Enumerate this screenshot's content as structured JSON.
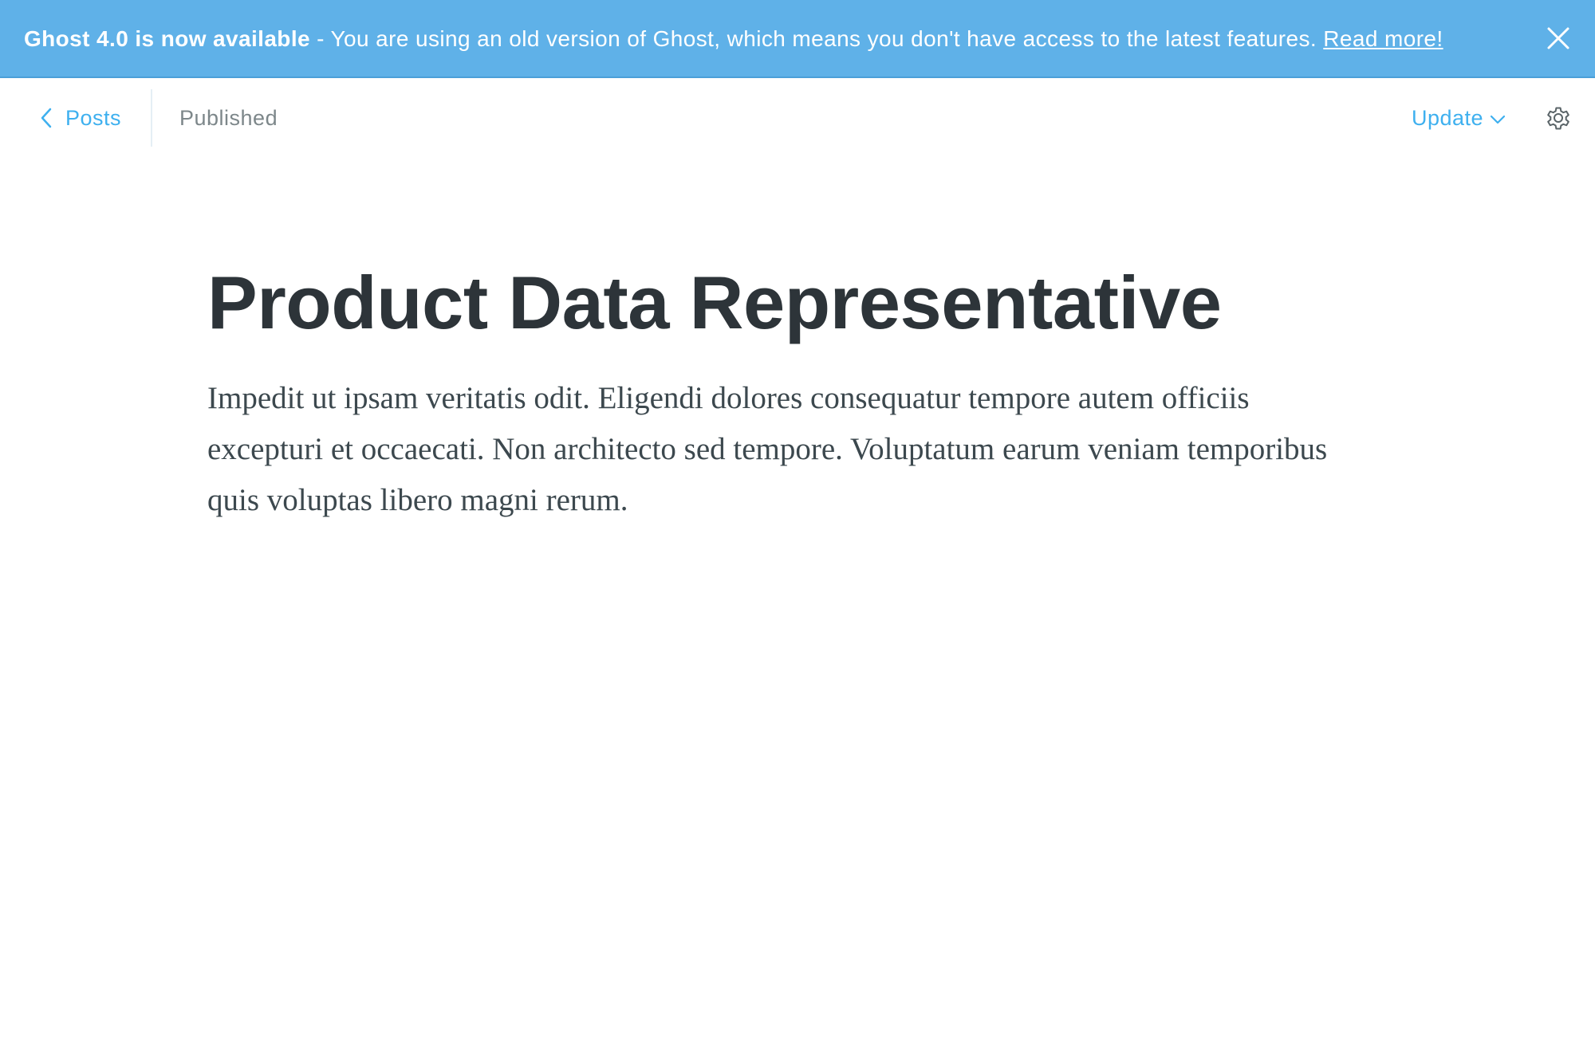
{
  "banner": {
    "headline": "Ghost 4.0 is now available",
    "separator": " - ",
    "message": "You are using an old version of Ghost, which means you don't have access to the latest features.",
    "link_label": "Read more!",
    "close_icon": "close-icon",
    "background_color": "#5fb1e8"
  },
  "toolbar": {
    "back_label": "Posts",
    "back_icon": "chevron-left-icon",
    "status": "Published",
    "update_label": "Update",
    "update_icon": "chevron-down-icon",
    "settings_icon": "gear-icon",
    "accent_color": "#3eb0ef"
  },
  "post": {
    "title": "Product Data Representative",
    "body": "Impedit ut ipsam veritatis odit. Eligendi dolores consequatur tempore autem officiis excepturi et occaecati. Non architecto sed tempore. Voluptatum earum veniam temporibus quis voluptas libero magni rerum."
  }
}
